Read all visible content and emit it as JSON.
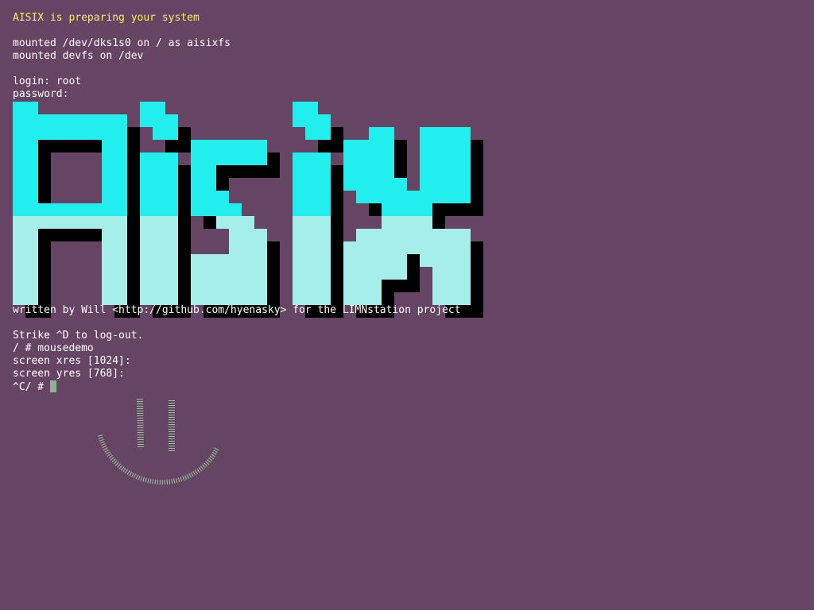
{
  "console": {
    "boot_message": "AISIX is preparing your system",
    "mount_root": "mounted /dev/dks1s0 on / as aisixfs",
    "mount_devfs": "mounted devfs on /dev",
    "login": "login: root",
    "password": "password:",
    "credits": "written by Will <http://github.com/hyenasky> for the LIMNstation project",
    "logout_hint": "Strike ^D to log-out.",
    "command": "/ # mousedemo",
    "xres_prompt": "screen xres [1024]:",
    "yres_prompt": "screen yres [768]:",
    "prompt": "^C/ # "
  },
  "logo": {
    "lettering": "AISIX",
    "top_color": "#22eeee",
    "bottom_color": "#a6eeea",
    "shadow_color": "#000000"
  },
  "mouse_drawing": {
    "icon": "smiley-drawing-icon",
    "color": "#9ec49a"
  },
  "colors": {
    "background": "#664564",
    "text": "#ffffff",
    "highlight": "#f2ee5a",
    "cursor": "#8bb58a"
  }
}
